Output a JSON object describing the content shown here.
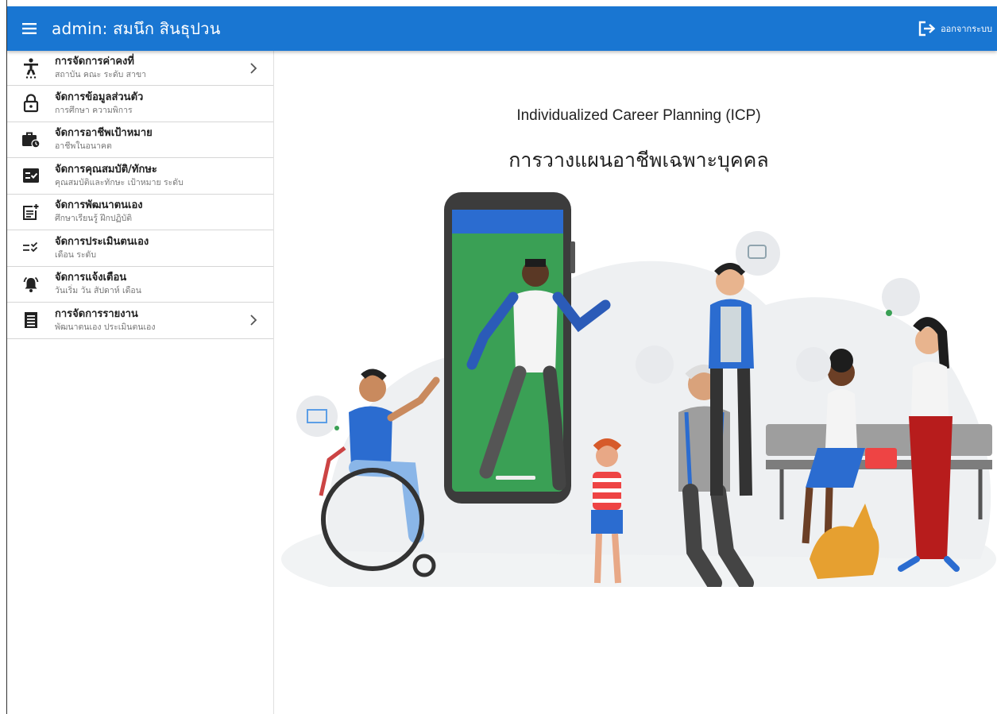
{
  "header": {
    "title": "admin: สมนึก สินธุปวน",
    "logout_label": "ออกจากระบบ"
  },
  "sidebar": {
    "items": [
      {
        "icon": "accessibility-icon",
        "title": "การจัดการค่าคงที่",
        "subtitle": "สถาบัน คณะ ระดับ สาขา",
        "expandable": true
      },
      {
        "icon": "lock-icon",
        "title": "จัดการข้อมูลส่วนตัว",
        "subtitle": "การศึกษา ความพิการ",
        "expandable": false
      },
      {
        "icon": "work-history-icon",
        "title": "จัดการอาชีพเป้าหมาย",
        "subtitle": "อาชีพในอนาคต",
        "expandable": false
      },
      {
        "icon": "fact-check-icon",
        "title": "จัดการคุณสมบัติ/ทักษะ",
        "subtitle": "คุณสมบัติและทักษะ เป้าหมาย ระดับ",
        "expandable": false
      },
      {
        "icon": "post-add-icon",
        "title": "จัดการพัฒนาตนเอง",
        "subtitle": "ศึกษาเรียนรู้ ฝึกปฏิบัติ",
        "expandable": false
      },
      {
        "icon": "rule-icon",
        "title": "จัดการประเมินตนเอง",
        "subtitle": "เดือน ระดับ",
        "expandable": false
      },
      {
        "icon": "alarm-bell-icon",
        "title": "จัดการแจ้งเตือน",
        "subtitle": "วันเริ่ม วัน สัปดาห์ เดือน",
        "expandable": false
      },
      {
        "icon": "receipt-icon",
        "title": "การจัดการรายงาน",
        "subtitle": "พัฒนาตนเอง ประเมินตนเอง",
        "expandable": true
      }
    ]
  },
  "main": {
    "title_en": "Individualized Career Planning (ICP)",
    "title_th": "การวางแผนอาชีพเฉพาะบุคคล"
  },
  "colors": {
    "appbar": "#1976d2",
    "phone_screen": "#3aa055",
    "accent_blue": "#2b6cd0",
    "accent_red": "#b71c1c",
    "dog": "#e6a030"
  }
}
